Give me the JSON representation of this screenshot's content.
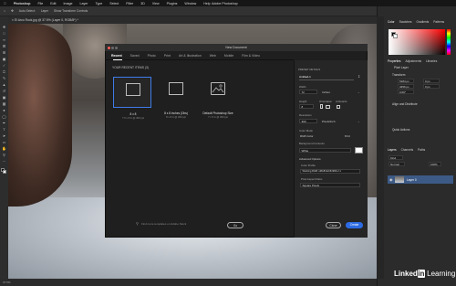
{
  "menubar": {
    "apple": "",
    "items": [
      "Photoshop",
      "File",
      "Edit",
      "Image",
      "Layer",
      "Type",
      "Select",
      "Filter",
      "3D",
      "View",
      "Plugins",
      "Window",
      "Help"
    ],
    "window_title": "Adobe Photoshop"
  },
  "options_bar": {
    "auto_select": "Auto-Select:",
    "auto_select_target": "Layer",
    "show_transform": "Show Transform Controls"
  },
  "document_tab": "× El Arco Rock.jpg @ 37.5% (Layer 0, RGB/8*) *",
  "status": "37.5%",
  "right_panel": {
    "tabs_top": [
      "Color",
      "Swatches",
      "Gradients",
      "Patterns"
    ],
    "tabs_mid": [
      "Properties",
      "Adjustments",
      "Libraries"
    ],
    "pixel_layer": "Pixel Layer",
    "transform": "Transform",
    "w_value": "5184 px",
    "h_value": "3456 px",
    "x_value": "0 px",
    "y_value": "0 px",
    "angle_value": "0.00°",
    "align": "Align and Distribute",
    "quick_actions": "Quick Actions",
    "tabs_layers": [
      "Layers",
      "Channels",
      "Paths"
    ],
    "kind": "Kind",
    "blend": "Normal",
    "opacity": "100%",
    "layer_name": "Layer 0"
  },
  "dialog": {
    "title": "New Document",
    "tabs": [
      "Recent",
      "Saved",
      "Photo",
      "Print",
      "Art & Illustration",
      "Web",
      "Mobile",
      "Film & Video"
    ],
    "active_tab": "Recent",
    "recent_label": "YOUR RECENT ITEMS (3)",
    "presets": [
      {
        "name": "8 x 8",
        "dims": "7.5 x 8 in @ 300 ppi"
      },
      {
        "name": "8 x 8 inches (Obs)",
        "dims": "8 x 8 in @ 300 ppi"
      },
      {
        "name": "Default Photoshop Size",
        "dims": "7 x 5 in @ 300 ppi"
      }
    ],
    "search_placeholder": "Find more templates on Adobe Stock",
    "go_label": "Go",
    "details": {
      "preset_details_label": "PRESET DETAILS",
      "name": "Untitled-1",
      "width_label": "Width",
      "width_value": "72",
      "width_unit": "Inches",
      "height_label": "Height",
      "height_value": "8",
      "orientation_label": "Orientation",
      "artboards_label": "Artboards",
      "resolution_label": "Resolution",
      "resolution_value": "300",
      "resolution_unit": "Pixels/Inch",
      "color_mode_label": "Color Mode",
      "color_mode_value": "RGB Color",
      "bit_depth": "8 bit",
      "background_label": "Background Contents",
      "background_value": "White",
      "advanced_label": "Advanced Options",
      "color_profile_label": "Color Profile",
      "color_profile_value": "Working RGB: sRGB IEC61966-2.1",
      "pixel_aspect_label": "Pixel Aspect Ratio",
      "pixel_aspect_value": "Square Pixels"
    },
    "close_label": "Close",
    "create_label": "Create"
  },
  "watermark": {
    "linked": "Linked",
    "in": "in",
    "learning": "Learning"
  },
  "colors": {
    "accent": "#2d6be4",
    "selected_border": "#3f7be8",
    "layer_selected": "#3d5a86"
  }
}
